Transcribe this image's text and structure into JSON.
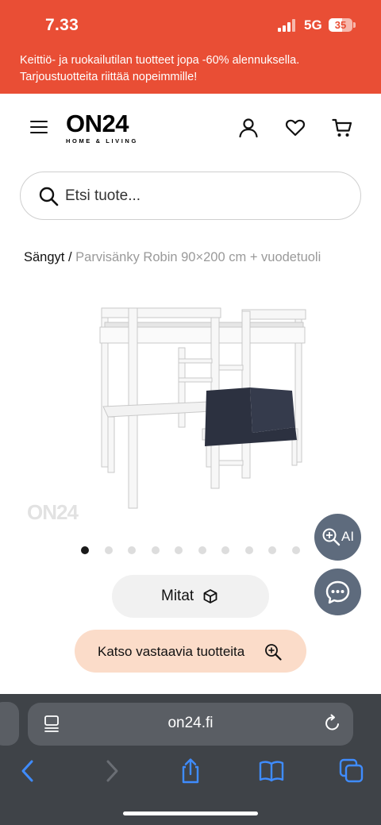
{
  "status_bar": {
    "time": "7.33",
    "network": "5G",
    "battery": "35"
  },
  "promo_banner": {
    "text": "Keittiö- ja ruokailutilan tuotteet jopa -60% alennuksella. Tarjoustuotteita riittää nopeimmille!"
  },
  "header": {
    "logo_main": "ON24",
    "logo_sub": "HOME & LIVING"
  },
  "search": {
    "placeholder": "Etsi tuote..."
  },
  "breadcrumb": {
    "category": "Sängyt",
    "separator": "/",
    "current": "Parvisänky Robin 90×200 cm + vuodetuoli"
  },
  "gallery": {
    "watermark": "ON24",
    "slide_count": 10,
    "active_slide": 1
  },
  "ai_button": {
    "label": "AI"
  },
  "buttons": {
    "dimensions_label": "Mitat",
    "similar_label": "Katso vastaavia tuotteita"
  },
  "browser": {
    "url": "on24.fi"
  },
  "colors": {
    "brand_red": "#e94e35",
    "fab_gray": "#5e6b7d",
    "similar_peach": "#fbdcc9",
    "ios_blue": "#3f8cff"
  }
}
